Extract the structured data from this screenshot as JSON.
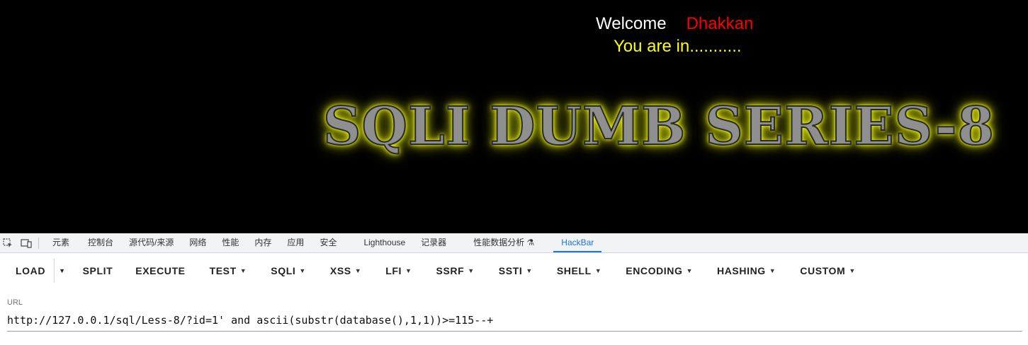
{
  "page": {
    "welcome": "Welcome",
    "name": "Dhakkan",
    "status": "You are in...........",
    "banner": "SQLI DUMB SERIES-8"
  },
  "devtools": {
    "tabs": [
      {
        "label": "元素"
      },
      {
        "label": "控制台"
      },
      {
        "label": "源代码/来源"
      },
      {
        "label": "网络"
      },
      {
        "label": "性能"
      },
      {
        "label": "内存"
      },
      {
        "label": "应用"
      },
      {
        "label": "安全"
      },
      {
        "label": "Lighthouse"
      },
      {
        "label": "记录器"
      },
      {
        "label": "性能数据分析 ⚗"
      },
      {
        "label": "HackBar"
      }
    ],
    "active_tab": "HackBar"
  },
  "hackbar": {
    "buttons": {
      "load": "LOAD",
      "split": "SPLIT",
      "execute": "EXECUTE",
      "test": "TEST",
      "sqli": "SQLI",
      "xss": "XSS",
      "lfi": "LFI",
      "ssrf": "SSRF",
      "ssti": "SSTI",
      "shell": "SHELL",
      "encoding": "ENCODING",
      "hashing": "HASHING",
      "custom": "CUSTOM"
    },
    "url_label": "URL",
    "url_value": "http://127.0.0.1/sql/Less-8/?id=1' and ascii(substr(database(),1,1))>=115--+"
  },
  "colors": {
    "welcome": "#ffffff",
    "name": "#ff0000",
    "status": "#ffff00",
    "banner_glow": "#e8f000",
    "active_tab": "#1a73e8"
  },
  "icons": [
    "inspect-element-icon",
    "device-toolbar-icon",
    "caret-down-icon"
  ]
}
